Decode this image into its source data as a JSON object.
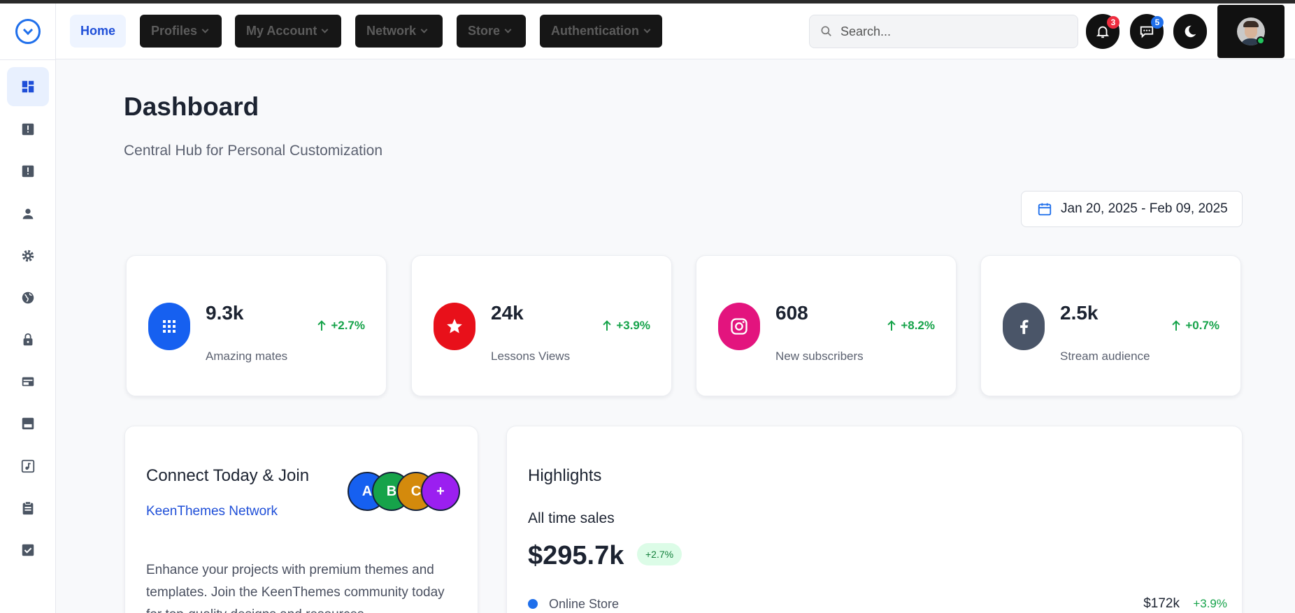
{
  "nav": {
    "home": "Home",
    "menus": [
      "Profiles",
      "My Account",
      "Network",
      "Store",
      "Authentication"
    ]
  },
  "search": {
    "placeholder": "Search..."
  },
  "header": {
    "notifications_count": "3",
    "messages_count": "5"
  },
  "icons": {
    "sidebar": [
      "dashboard-icon",
      "info-square-icon",
      "alert-square-icon",
      "user-icon",
      "gear-icon",
      "globe-icon",
      "lock-icon",
      "card-icon",
      "mp-icon",
      "music-icon",
      "clipboard-icon",
      "checkbox-icon"
    ]
  },
  "colors": {
    "accent": "#1f6feb",
    "positive": "#16a34a",
    "stat_icons": [
      "#1660f0",
      "#e8101a",
      "#e3147e",
      "#4a5568"
    ],
    "avatars": [
      "#1660f0",
      "#16a34a",
      "#d48a0c",
      "#9b1ff0"
    ]
  },
  "page": {
    "title": "Dashboard",
    "subtitle": "Central Hub for Personal Customization",
    "date_range": "Jan 20, 2025 - Feb 09, 2025"
  },
  "stats": [
    {
      "value": "9.3k",
      "label": "Amazing mates",
      "change": "+2.7%",
      "icon": "grid-icon"
    },
    {
      "value": "24k",
      "label": "Lessons Views",
      "change": "+3.9%",
      "icon": "star-icon"
    },
    {
      "value": "608",
      "label": "New subscribers",
      "change": "+8.2%",
      "icon": "instagram-icon"
    },
    {
      "value": "2.5k",
      "label": "Stream audience",
      "change": "+0.7%",
      "icon": "facebook-icon"
    }
  ],
  "connect": {
    "title": "Connect Today & Join",
    "link": "KeenThemes Network",
    "text": "Enhance your projects with premium themes and templates. Join the KeenThemes community today for top-quality designs and resources.",
    "avatars": [
      "A",
      "B",
      "C",
      "+"
    ]
  },
  "highlights": {
    "title": "Highlights",
    "subtitle": "All time sales",
    "total": "$295.7k",
    "change": "+2.7%",
    "rows": [
      {
        "label": "Online Store",
        "value": "$172k",
        "change": "+3.9%"
      }
    ]
  }
}
